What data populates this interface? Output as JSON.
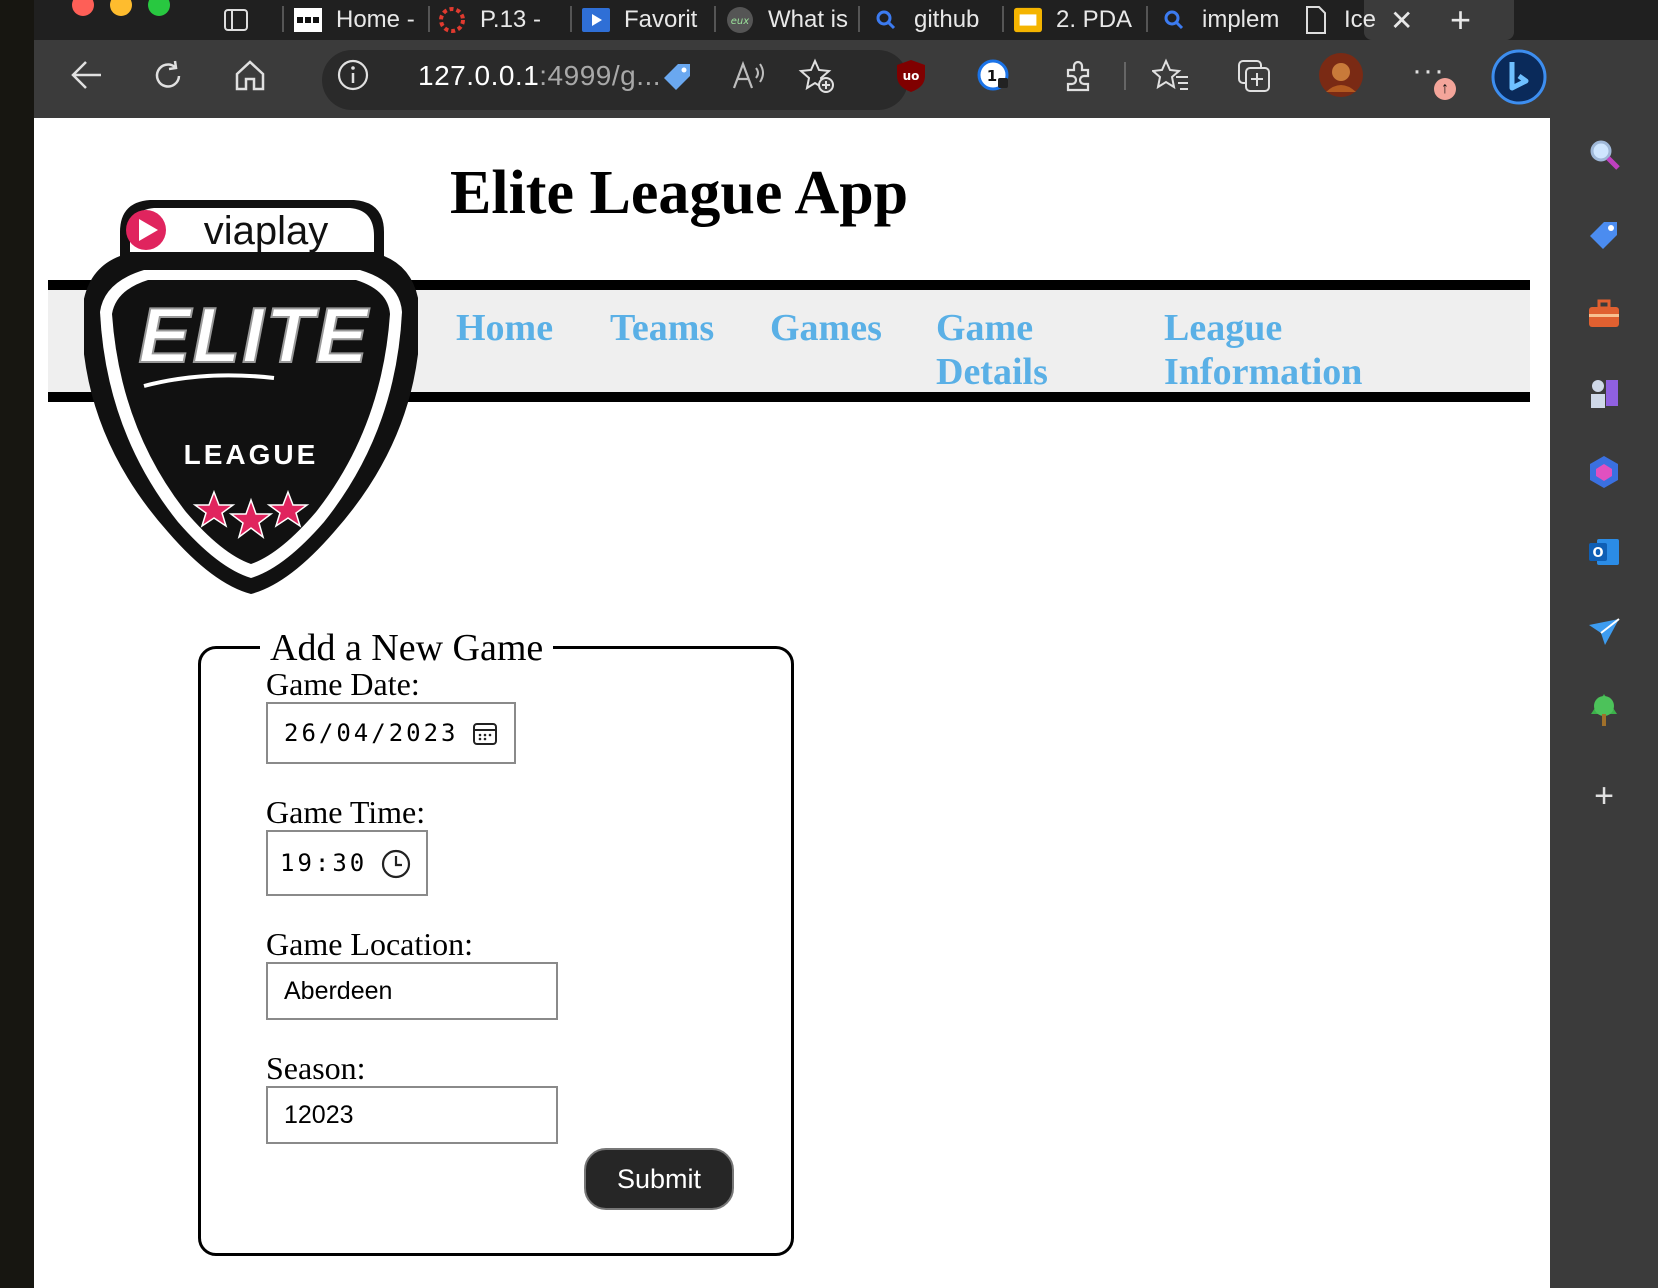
{
  "browser": {
    "tabs": [
      {
        "label": "",
        "icon": "tab-actions-icon"
      },
      {
        "label": "Home -",
        "icon": "grid-favicon-icon"
      },
      {
        "label": "P.13 -",
        "icon": "red-circle-favicon-icon"
      },
      {
        "label": "Favorit",
        "icon": "video-favicon-icon"
      },
      {
        "label": "What is",
        "icon": "eux-favicon-icon"
      },
      {
        "label": "github",
        "icon": "search-favicon-icon"
      },
      {
        "label": "2. PDA",
        "icon": "slides-favicon-icon"
      },
      {
        "label": "implem",
        "icon": "search-favicon-icon"
      },
      {
        "label": "Ice",
        "icon": "page-favicon-icon"
      }
    ],
    "url_host": "127.0.0.1",
    "url_rest": ":4999/g...",
    "notification_badge": "↑"
  },
  "app": {
    "title": "Elite League App",
    "logo": {
      "brand": "viaplay",
      "word": "ELITE",
      "sub": "LEAGUE"
    },
    "nav": [
      {
        "line1": "Home",
        "line2": ""
      },
      {
        "line1": "Teams",
        "line2": ""
      },
      {
        "line1": "Games",
        "line2": ""
      },
      {
        "line1": "Game",
        "line2": "Details"
      },
      {
        "line1": "League",
        "line2": "Information"
      }
    ]
  },
  "form": {
    "legend": "Add a New Game",
    "date_label": "Game Date:",
    "date_value": "26/04/2023",
    "time_label": "Game Time:",
    "time_value": "19:30",
    "location_label": "Game Location:",
    "location_value": "Aberdeen",
    "season_label": "Season:",
    "season_value": "12023",
    "submit_label": "Submit"
  },
  "colors": {
    "nav_link": "#5ab0e6",
    "nav_bg": "#efefef",
    "submit_bg": "#262626",
    "browser_toolbar": "#3b3b3b",
    "logo_red": "#e0245e"
  }
}
